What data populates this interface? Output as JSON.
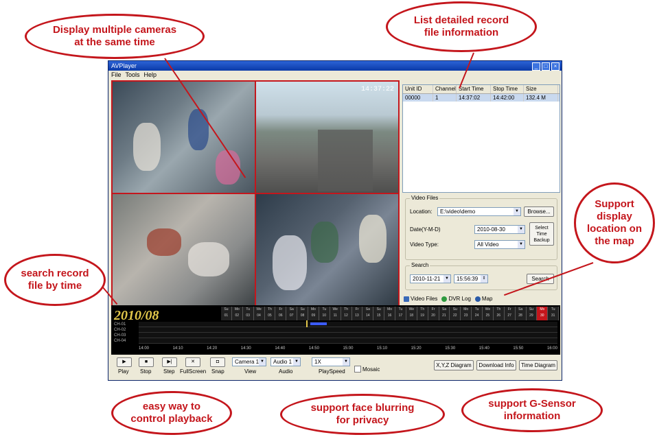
{
  "callouts": {
    "multi_camera": "Display multiple cameras\nat the same time",
    "record_info": "List detailed record\nfile information",
    "map": "Support\ndisplay\nlocation on\nthe map",
    "search_time": "search record\nfile by time",
    "playback": "easy way  to\ncontrol playback",
    "face_blur": "support face blurring\nfor privacy",
    "gsensor": "support G-Sensor\ninformation"
  },
  "window": {
    "title": "AVPlayer",
    "menu": [
      "File",
      "Tools",
      "Help"
    ]
  },
  "osd_time": "14:37:22",
  "file_list": {
    "headers": [
      "Unit ID",
      "Channel",
      "Start Time",
      "Stop Time",
      "Size"
    ],
    "rows": [
      [
        "00000",
        "1",
        "14:37:02",
        "14:42:00",
        "132.4 M"
      ]
    ]
  },
  "video_files": {
    "group_label": "Video Files",
    "location_label": "Location:",
    "location_value": "E:\\video\\demo",
    "browse_label": "Browse...",
    "date_label": "Date(Y-M-D)",
    "date_value": "2010-08-30",
    "select_time_backup": "Select\nTime\nBackup",
    "video_type_label": "Video Type:",
    "video_type_value": "All Video"
  },
  "search": {
    "group_label": "Search",
    "date_value": "2010-11-21",
    "time_value": "15:56:39",
    "search_label": "Search"
  },
  "tabs": [
    "Video Files",
    "DVR Log",
    "Map"
  ],
  "timeline": {
    "month": "2010/08",
    "weekday_labels": [
      "Su",
      "Mo",
      "Tu",
      "We",
      "Th",
      "Fr",
      "Sa",
      "Su",
      "Mo",
      "Tu",
      "We",
      "Th",
      "Fr",
      "Sa",
      "Su",
      "Mo",
      "Tu",
      "We",
      "Th",
      "Fr",
      "Sa",
      "Su",
      "Mo",
      "Tu",
      "We",
      "Th",
      "Fr",
      "Sa",
      "Su",
      "Mo",
      "Tu"
    ],
    "day_numbers": [
      "01",
      "02",
      "03",
      "04",
      "05",
      "06",
      "07",
      "08",
      "09",
      "10",
      "11",
      "12",
      "13",
      "14",
      "15",
      "16",
      "17",
      "18",
      "19",
      "20",
      "21",
      "22",
      "23",
      "24",
      "25",
      "26",
      "27",
      "28",
      "29",
      "30",
      "31"
    ],
    "selected_day_index": 29,
    "channels": [
      "CH-01",
      "CH-02",
      "CH-03",
      "CH-04"
    ],
    "ticks": [
      "14:00",
      "14:10",
      "14:20",
      "14:30",
      "14:40",
      "14:50",
      "15:00",
      "15:10",
      "15:20",
      "15:30",
      "15:40",
      "15:50",
      "16:00"
    ]
  },
  "controls": {
    "play": "Play",
    "stop": "Stop",
    "step": "Step",
    "fullscreen": "FullScreen",
    "snap": "Snap",
    "camera_value": "Camera 1",
    "view_label": "View",
    "audio_value": "Audio 1",
    "audio_label": "Audio",
    "speed_value": "1X",
    "speed_label": "PlaySpeed",
    "mosaic": "Mosaic",
    "xyz_diagram": "X,Y,Z Diagram",
    "download_info": "Download Info",
    "time_diagram": "Time Diagram"
  },
  "colors": {
    "accent_red": "#c4161c",
    "timeline_month": "#e2c74a",
    "window_title": "#0b3aa8"
  }
}
